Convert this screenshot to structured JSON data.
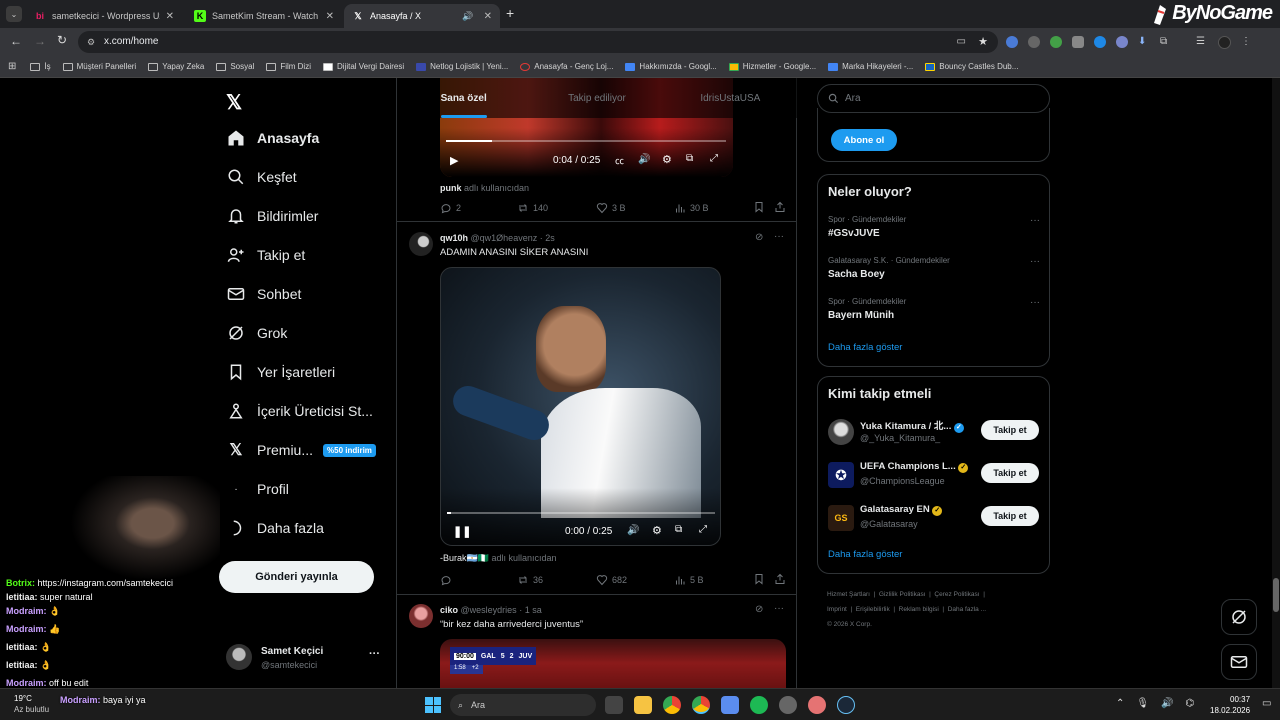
{
  "browser": {
    "tabs": [
      {
        "label": "sametkecici - Wordpress Uzman",
        "icon": "bi-icon",
        "color": "#e91e63"
      },
      {
        "label": "SametKim Stream - Watch Live",
        "icon": "kick-icon",
        "color": "#53fc18"
      },
      {
        "label": "Anasayfa / X",
        "icon": "x-icon",
        "color": "#ffffff"
      }
    ],
    "new_tab": "+",
    "url": "x.com/home",
    "bookmarks": [
      "İş",
      "Müşteri Panelleri",
      "Yapay Zeka",
      "Sosyal",
      "Film Dizi",
      "Dijital Vergi Dairesi",
      "Netlog Lojistik | Yeni...",
      "Anasayfa - Genç Loj...",
      "Hakkımızda - Googl...",
      "Hizmetler - Google...",
      "Marka Hikayeleri -...",
      "Bouncy Castles Dub..."
    ],
    "watermark": "ByNoGame"
  },
  "nav": {
    "items": [
      {
        "label": "Anasayfa",
        "icon": "home-icon"
      },
      {
        "label": "Keşfet",
        "icon": "search-icon"
      },
      {
        "label": "Bildirimler",
        "icon": "bell-icon"
      },
      {
        "label": "Takip et",
        "icon": "follow-icon"
      },
      {
        "label": "Sohbet",
        "icon": "mail-icon"
      },
      {
        "label": "Grok",
        "icon": "grok-icon"
      },
      {
        "label": "Yer İşaretleri",
        "icon": "bookmark-icon"
      },
      {
        "label": "İçerik Üreticisi St...",
        "icon": "creator-icon"
      },
      {
        "label": "Premiu...",
        "icon": "x-icon"
      },
      {
        "label": "Profil",
        "icon": "profile-icon"
      },
      {
        "label": "Daha fazla",
        "icon": "more-icon"
      }
    ],
    "premium_badge": "%50 indirim",
    "post_button": "Gönderi yayınla",
    "account": {
      "name": "Samet Keçici",
      "handle": "@samtekecici",
      "more": "···"
    }
  },
  "feed": {
    "tabs": [
      "Sana özel",
      "Takip ediliyor",
      "IdrisUstaUSA"
    ],
    "post1": {
      "video_time": "0:04 / 0:25",
      "from_user": "punk",
      "from_suffix": "adlı kullanıcıdan",
      "replies": "2",
      "reposts": "140",
      "likes": "3 B",
      "views": "30 B"
    },
    "post2": {
      "name": "qw10h",
      "handle": "@qw1Øheavenz",
      "time": "· 2s",
      "text": "ADAMIN ANASINI SİKER ANASINI",
      "video_time": "0:00 / 0:25",
      "from_user": "-Burak🇦🇷🇳🇬",
      "from_suffix": "adlı kullanıcıdan",
      "reposts": "36",
      "likes": "682",
      "views": "5 B"
    },
    "post3": {
      "name": "ciko",
      "handle": "@wesleydries",
      "time": "· 1 sa",
      "text": "“bir kez daha arrivederci juventus”",
      "score": {
        "clock": "90:00",
        "home": "GAL",
        "home_goals": "5",
        "away_goals": "2",
        "away": "JUV",
        "sub_clock": "1:58",
        "sub_extra": "+2"
      }
    }
  },
  "sidebar": {
    "search_placeholder": "Ara",
    "subscribe": "Abone ol",
    "trends_title": "Neler oluyor?",
    "trends": [
      {
        "category": "Spor · Gündemdekiler",
        "name": "#GSvJUVE"
      },
      {
        "category": "Galatasaray S.K. · Gündemdekiler",
        "name": "Sacha Boey"
      },
      {
        "category": "Spor · Gündemdekiler",
        "name": "Bayern Münih"
      }
    ],
    "show_more": "Daha fazla göster",
    "who_title": "Kimi takip etmeli",
    "who": [
      {
        "name": "Yuka Kitamura / 北...",
        "handle": "@_Yuka_Kitamura_",
        "verified": "blue"
      },
      {
        "name": "UEFA Champions L...",
        "handle": "@ChampionsLeague",
        "verified": "gold"
      },
      {
        "name": "Galatasaray EN",
        "handle": "@Galatasaray",
        "verified": "gold"
      }
    ],
    "follow_label": "Takip et",
    "footer": [
      "Hizmet Şartları",
      "Gizlilik Politikası",
      "Çerez Politikası",
      "Imprint",
      "Erişilebilirlik",
      "Reklam bilgisi",
      "Daha fazla ...",
      "© 2026 X Corp."
    ]
  },
  "chat": [
    {
      "user": "Botrix:",
      "text": "https://instagram.com/samtekecici"
    },
    {
      "user": "letitiaa:",
      "text": "super natural"
    },
    {
      "user": "Modraim:",
      "text": "👌"
    },
    {
      "user": "Modraim:",
      "text": "👍"
    },
    {
      "user": "letitiaa:",
      "text": "👌"
    },
    {
      "user": "letitiaa:",
      "text": "👌"
    },
    {
      "user": "Modraim:",
      "text": "off bu edit"
    },
    {
      "user": "Modraim:",
      "text": "baya iyi ya"
    }
  ],
  "taskbar": {
    "weather": "19°C",
    "weather_desc": "Az bulutlu",
    "search": "Ara",
    "time": "00:37",
    "date": "18.02.2026"
  }
}
